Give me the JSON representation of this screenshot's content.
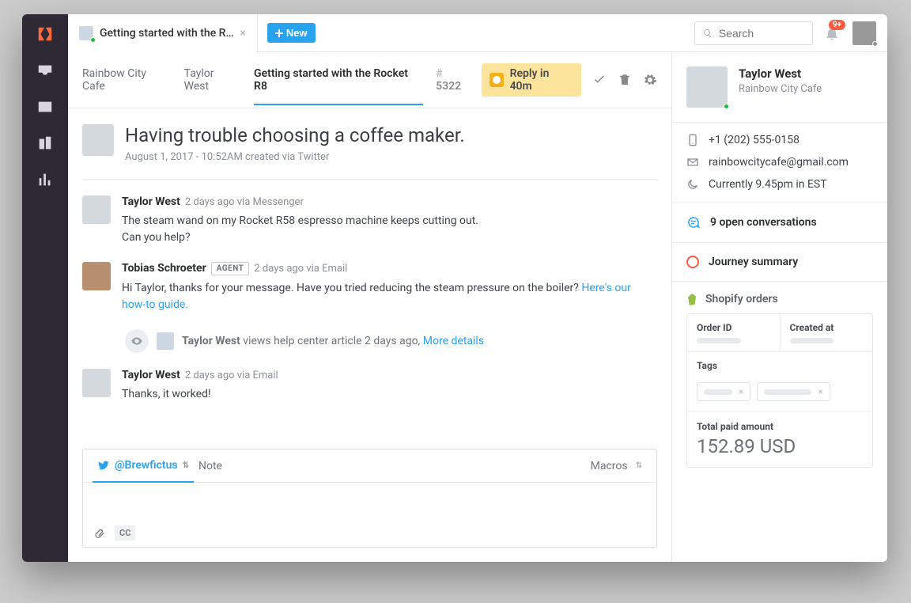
{
  "header": {
    "tab_title": "Getting started with the R…",
    "new_label": "New",
    "search_placeholder": "Search",
    "notification_badge": "9+"
  },
  "breadcrumb": {
    "org": "Rainbow City Cafe",
    "user": "Taylor West",
    "subject": "Getting started with the Rocket R8",
    "ticket_hash": "# ",
    "ticket_id": "5322",
    "reply_label": "Reply in 40m"
  },
  "thread": {
    "title": "Having trouble choosing a coffee maker.",
    "created_meta": "August 1, 2017 - 10:52AM created via Twitter",
    "m1": {
      "from": "Taylor West",
      "meta": "2 days ago via Messenger",
      "l1": "The steam wand on my Rocket R58 espresso machine keeps cutting out.",
      "l2": "Can you help?"
    },
    "m2": {
      "from": "Tobias Schroeter",
      "tag": "AGENT",
      "meta": "2 days ago via Email",
      "txt": "Hi Taylor, thanks for your message. Have you tried reducing the steam pressure on the boiler? ",
      "link": "Here's our how-to guide."
    },
    "event": {
      "who": "Taylor West",
      "rest": " views help center article 2 days ago, ",
      "more": "More details"
    },
    "m3": {
      "from": "Taylor West",
      "meta": "2 days ago via Email",
      "txt": "Thanks, it worked!"
    }
  },
  "composer": {
    "handle": "@Brewfictus",
    "note_label": "Note",
    "macros_label": "Macros",
    "cc_label": "CC"
  },
  "profile": {
    "name": "Taylor West",
    "org": "Rainbow City Cafe",
    "phone": "+1 (202) 555-0158",
    "email": "rainbowcitycafe@gmail.com",
    "time": "Currently 9.45pm in EST",
    "open_conv": "9 open conversations",
    "journey": "Journey summary"
  },
  "shopify": {
    "title": "Shopify orders",
    "order_id": "Order ID",
    "created_at": "Created at",
    "tags": "Tags",
    "total_label": "Total paid amount",
    "total_value": "152.89 USD"
  },
  "colors": {
    "accent": "#28a3ef",
    "warn": "#ff5b3f"
  }
}
